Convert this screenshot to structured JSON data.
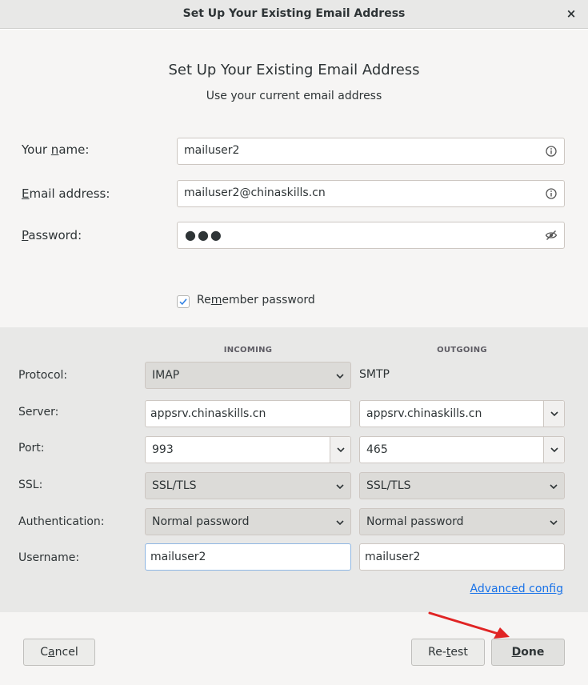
{
  "window": {
    "title": "Set Up Your Existing Email Address",
    "close_glyph": "×"
  },
  "header": {
    "title": "Set Up Your Existing Email Address",
    "subtitle": "Use your current email address"
  },
  "account": {
    "name": {
      "label_pre": "Your ",
      "label_mnemonic": "n",
      "label_post": "ame:",
      "value": "mailuser2",
      "icon": "info-icon"
    },
    "email": {
      "label_pre": "",
      "label_mnemonic": "E",
      "label_post": "mail address:",
      "value": "mailuser2@chinaskills.cn",
      "icon": "info-icon"
    },
    "password": {
      "label_pre": "",
      "label_mnemonic": "P",
      "label_post": "assword:",
      "masked": "●●●",
      "icon": "eye-slash-icon"
    },
    "remember": {
      "label_pre": "Re",
      "label_mnemonic": "m",
      "label_post": "ember password",
      "checked": true
    }
  },
  "server": {
    "incoming_header": "INCOMING",
    "outgoing_header": "OUTGOING",
    "labels": {
      "protocol": "Protocol:",
      "server": "Server:",
      "port": "Port:",
      "ssl": "SSL:",
      "auth": "Authentication:",
      "username": "Username:"
    },
    "incoming": {
      "protocol": "IMAP",
      "server": "appsrv.chinaskills.cn",
      "port": "993",
      "ssl": "SSL/TLS",
      "auth": "Normal password",
      "username": "mailuser2"
    },
    "outgoing": {
      "protocol": "SMTP",
      "server": "appsrv.chinaskills.cn",
      "port": "465",
      "ssl": "SSL/TLS",
      "auth": "Normal password",
      "username": "mailuser2"
    },
    "advanced": {
      "pre": "",
      "mnemonic": "A",
      "post": "dvanced config"
    }
  },
  "footer": {
    "cancel": {
      "pre": "C",
      "mnemonic": "a",
      "post": "ncel"
    },
    "retest": {
      "pre": "Re-",
      "mnemonic": "t",
      "post": "est"
    },
    "done": {
      "pre": "",
      "mnemonic": "D",
      "post": "one"
    }
  },
  "colors": {
    "dialog_bg": "#f6f5f4",
    "server_bg": "#e8e8e7",
    "link": "#1a73e8",
    "annotation_arrow": "#e02424"
  }
}
